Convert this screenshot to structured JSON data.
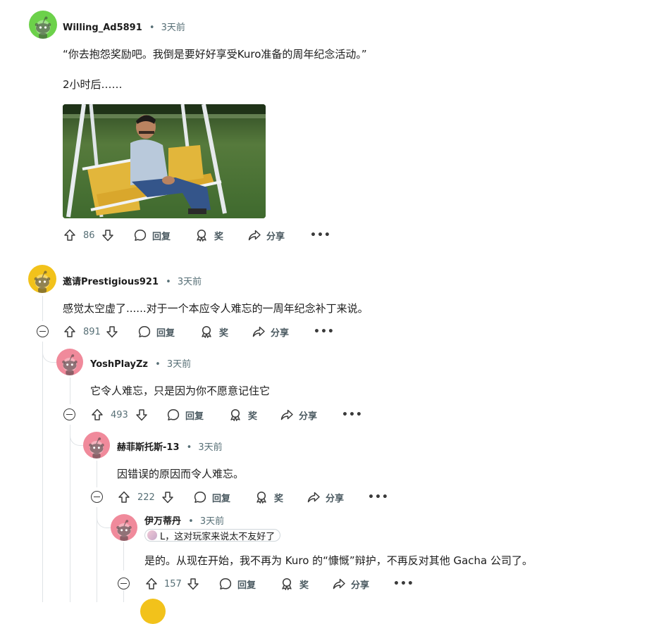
{
  "comments": [
    {
      "id": "c1",
      "username": "Willing_Ad5891",
      "time": "3天前",
      "body_line1": "“你去抱怨奖励吧。我倒是要好好享受Kuro准备的周年纪念活动。”",
      "body_line2": "2小时后……",
      "votes": "86",
      "reply_label": "回复",
      "award_label": "奖",
      "share_label": "分享",
      "more_label": "•••",
      "avatar_color": "#6cd14a"
    },
    {
      "id": "c2",
      "username": "邀请Prestigious921",
      "time": "3天前",
      "body": "感觉太空虚了......对于一个本应令人难忘的一周年纪念补丁来说。",
      "votes": "891",
      "reply_label": "回复",
      "award_label": "奖",
      "share_label": "分享",
      "more_label": "•••",
      "avatar_color": "#f2c21b"
    },
    {
      "id": "c3",
      "username": "YoshPlayZz",
      "time": "3天前",
      "body": "它令人难忘，只是因为你不愿意记住它",
      "votes": "493",
      "reply_label": "回复",
      "award_label": "奖",
      "share_label": "分享",
      "more_label": "•••",
      "avatar_color": "#f08a9b"
    },
    {
      "id": "c4",
      "username": "赫菲斯托斯-13",
      "time": "3天前",
      "body": "因错误的原因而令人难忘。",
      "votes": "222",
      "reply_label": "回复",
      "award_label": "奖",
      "share_label": "分享",
      "more_label": "•••",
      "avatar_color": "#f08a9b"
    },
    {
      "id": "c5",
      "username": "伊万蒂丹",
      "time": "3天前",
      "flair": "L，这对玩家来说太不友好了",
      "body": "是的。从现在开始，我不再为 Kuro 的“慷慨”辩护，不再反对其他 Gacha 公司了。",
      "votes": "157",
      "reply_label": "回复",
      "award_label": "奖",
      "share_label": "分享",
      "more_label": "•••",
      "avatar_color": "#f08a9b"
    }
  ],
  "separator": "•"
}
